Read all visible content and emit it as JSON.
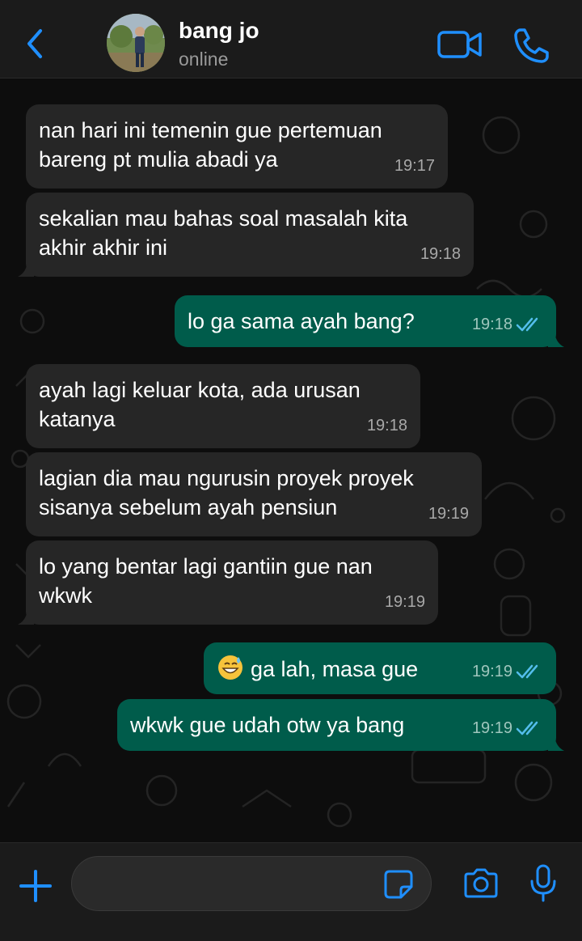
{
  "header": {
    "contact_name": "bang jo",
    "status": "online",
    "icons": [
      "chevron-left-icon",
      "video-camera-icon",
      "phone-icon"
    ]
  },
  "colors": {
    "accent": "#1f8fff",
    "incoming_bubble": "#262626",
    "outgoing_bubble": "#005c4b",
    "read_ticks": "#53bdeb"
  },
  "messages": [
    {
      "direction": "in",
      "text": "nan hari ini temenin gue pertemuan bareng pt mulia abadi ya",
      "time": "19:17"
    },
    {
      "direction": "in",
      "text": "sekalian mau bahas soal masalah kita akhir akhir ini",
      "time": "19:18"
    },
    {
      "direction": "out",
      "text": "lo ga sama ayah bang?",
      "time": "19:18",
      "status": "read"
    },
    {
      "direction": "in",
      "text": "ayah lagi keluar kota, ada urusan katanya",
      "time": "19:18"
    },
    {
      "direction": "in",
      "text": "lagian dia mau ngurusin proyek proyek sisanya sebelum ayah pensiun",
      "time": "19:19"
    },
    {
      "direction": "in",
      "text": "lo yang bentar lagi gantiin gue nan wkwk",
      "time": "19:19"
    },
    {
      "direction": "out",
      "emoji": "grinning-sweat-emoji",
      "text": "ga lah, masa gue",
      "time": "19:19",
      "status": "read"
    },
    {
      "direction": "out",
      "text": "wkwk gue udah otw ya bang",
      "time": "19:19",
      "status": "read"
    }
  ],
  "composer": {
    "value": "",
    "icons": [
      "plus-icon",
      "sticker-icon",
      "camera-icon",
      "microphone-icon"
    ]
  }
}
